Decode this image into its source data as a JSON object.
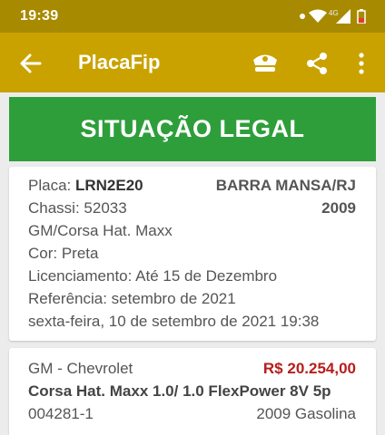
{
  "status_bar": {
    "time": "19:39",
    "network_label": "4G",
    "icons": [
      "notification-dot-icon",
      "wifi-icon",
      "signal-icon",
      "battery-icon"
    ]
  },
  "app_bar": {
    "title": "PlacaFip",
    "icons": [
      "back-arrow-icon",
      "police-hat-icon",
      "share-icon",
      "more-vert-icon"
    ],
    "color": "#c9a200"
  },
  "banner": {
    "text": "SITUAÇÃO LEGAL",
    "color": "#2e9e3b"
  },
  "vehicle": {
    "placa_label": "Placa:",
    "placa_value": "LRN2E20",
    "chassi": "Chassi: 52033",
    "location": "BARRA MANSA/RJ",
    "year": "2009",
    "brand_model": "GM/Corsa Hat. Maxx",
    "color": "Cor: Preta",
    "licenciamento": "Licenciamento: Até 15 de Dezembro",
    "referencia": "Referência: setembro de 2021",
    "consulta": "sexta-feira, 10 de setembro de 2021 19:38"
  },
  "fipe": {
    "brand": "GM - Chevrolet",
    "price": "R$ 20.254,00",
    "model": "Corsa Hat. Maxx 1.0/ 1.0 FlexPower 8V 5p",
    "code": "004281-1",
    "year_fuel": "2009 Gasolina",
    "price_color": "#b71c1c"
  }
}
